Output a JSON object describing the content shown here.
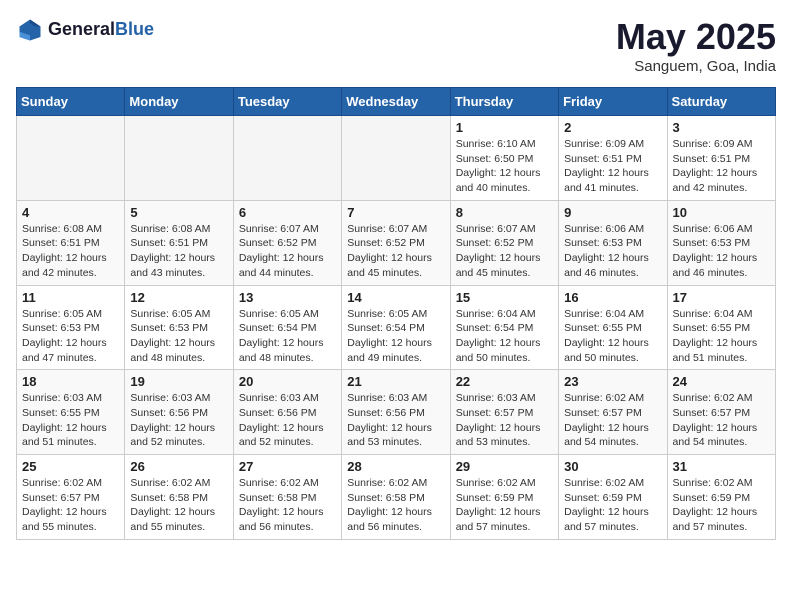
{
  "header": {
    "logo_line1": "General",
    "logo_line2": "Blue",
    "month": "May 2025",
    "location": "Sanguem, Goa, India"
  },
  "days_of_week": [
    "Sunday",
    "Monday",
    "Tuesday",
    "Wednesday",
    "Thursday",
    "Friday",
    "Saturday"
  ],
  "weeks": [
    [
      {
        "day": "",
        "info": ""
      },
      {
        "day": "",
        "info": ""
      },
      {
        "day": "",
        "info": ""
      },
      {
        "day": "",
        "info": ""
      },
      {
        "day": "1",
        "info": "Sunrise: 6:10 AM\nSunset: 6:50 PM\nDaylight: 12 hours\nand 40 minutes."
      },
      {
        "day": "2",
        "info": "Sunrise: 6:09 AM\nSunset: 6:51 PM\nDaylight: 12 hours\nand 41 minutes."
      },
      {
        "day": "3",
        "info": "Sunrise: 6:09 AM\nSunset: 6:51 PM\nDaylight: 12 hours\nand 42 minutes."
      }
    ],
    [
      {
        "day": "4",
        "info": "Sunrise: 6:08 AM\nSunset: 6:51 PM\nDaylight: 12 hours\nand 42 minutes."
      },
      {
        "day": "5",
        "info": "Sunrise: 6:08 AM\nSunset: 6:51 PM\nDaylight: 12 hours\nand 43 minutes."
      },
      {
        "day": "6",
        "info": "Sunrise: 6:07 AM\nSunset: 6:52 PM\nDaylight: 12 hours\nand 44 minutes."
      },
      {
        "day": "7",
        "info": "Sunrise: 6:07 AM\nSunset: 6:52 PM\nDaylight: 12 hours\nand 45 minutes."
      },
      {
        "day": "8",
        "info": "Sunrise: 6:07 AM\nSunset: 6:52 PM\nDaylight: 12 hours\nand 45 minutes."
      },
      {
        "day": "9",
        "info": "Sunrise: 6:06 AM\nSunset: 6:53 PM\nDaylight: 12 hours\nand 46 minutes."
      },
      {
        "day": "10",
        "info": "Sunrise: 6:06 AM\nSunset: 6:53 PM\nDaylight: 12 hours\nand 46 minutes."
      }
    ],
    [
      {
        "day": "11",
        "info": "Sunrise: 6:05 AM\nSunset: 6:53 PM\nDaylight: 12 hours\nand 47 minutes."
      },
      {
        "day": "12",
        "info": "Sunrise: 6:05 AM\nSunset: 6:53 PM\nDaylight: 12 hours\nand 48 minutes."
      },
      {
        "day": "13",
        "info": "Sunrise: 6:05 AM\nSunset: 6:54 PM\nDaylight: 12 hours\nand 48 minutes."
      },
      {
        "day": "14",
        "info": "Sunrise: 6:05 AM\nSunset: 6:54 PM\nDaylight: 12 hours\nand 49 minutes."
      },
      {
        "day": "15",
        "info": "Sunrise: 6:04 AM\nSunset: 6:54 PM\nDaylight: 12 hours\nand 50 minutes."
      },
      {
        "day": "16",
        "info": "Sunrise: 6:04 AM\nSunset: 6:55 PM\nDaylight: 12 hours\nand 50 minutes."
      },
      {
        "day": "17",
        "info": "Sunrise: 6:04 AM\nSunset: 6:55 PM\nDaylight: 12 hours\nand 51 minutes."
      }
    ],
    [
      {
        "day": "18",
        "info": "Sunrise: 6:03 AM\nSunset: 6:55 PM\nDaylight: 12 hours\nand 51 minutes."
      },
      {
        "day": "19",
        "info": "Sunrise: 6:03 AM\nSunset: 6:56 PM\nDaylight: 12 hours\nand 52 minutes."
      },
      {
        "day": "20",
        "info": "Sunrise: 6:03 AM\nSunset: 6:56 PM\nDaylight: 12 hours\nand 52 minutes."
      },
      {
        "day": "21",
        "info": "Sunrise: 6:03 AM\nSunset: 6:56 PM\nDaylight: 12 hours\nand 53 minutes."
      },
      {
        "day": "22",
        "info": "Sunrise: 6:03 AM\nSunset: 6:57 PM\nDaylight: 12 hours\nand 53 minutes."
      },
      {
        "day": "23",
        "info": "Sunrise: 6:02 AM\nSunset: 6:57 PM\nDaylight: 12 hours\nand 54 minutes."
      },
      {
        "day": "24",
        "info": "Sunrise: 6:02 AM\nSunset: 6:57 PM\nDaylight: 12 hours\nand 54 minutes."
      }
    ],
    [
      {
        "day": "25",
        "info": "Sunrise: 6:02 AM\nSunset: 6:57 PM\nDaylight: 12 hours\nand 55 minutes."
      },
      {
        "day": "26",
        "info": "Sunrise: 6:02 AM\nSunset: 6:58 PM\nDaylight: 12 hours\nand 55 minutes."
      },
      {
        "day": "27",
        "info": "Sunrise: 6:02 AM\nSunset: 6:58 PM\nDaylight: 12 hours\nand 56 minutes."
      },
      {
        "day": "28",
        "info": "Sunrise: 6:02 AM\nSunset: 6:58 PM\nDaylight: 12 hours\nand 56 minutes."
      },
      {
        "day": "29",
        "info": "Sunrise: 6:02 AM\nSunset: 6:59 PM\nDaylight: 12 hours\nand 57 minutes."
      },
      {
        "day": "30",
        "info": "Sunrise: 6:02 AM\nSunset: 6:59 PM\nDaylight: 12 hours\nand 57 minutes."
      },
      {
        "day": "31",
        "info": "Sunrise: 6:02 AM\nSunset: 6:59 PM\nDaylight: 12 hours\nand 57 minutes."
      }
    ]
  ]
}
